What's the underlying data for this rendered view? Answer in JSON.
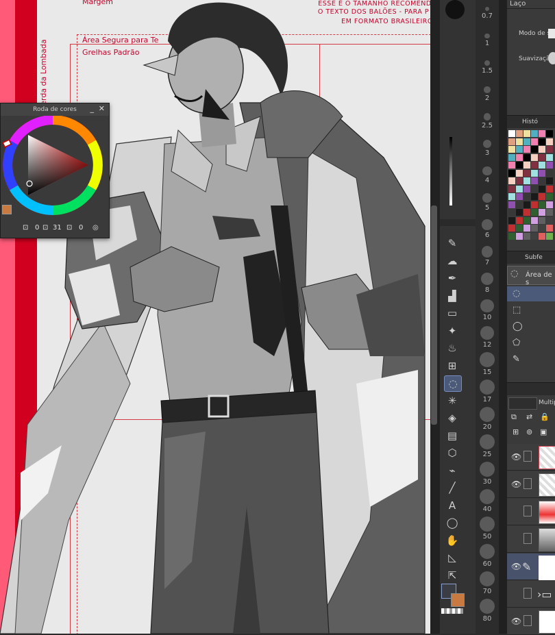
{
  "canvas": {
    "margin_label": "Margem",
    "lombada_label": "Perda da Lombada",
    "safe_area_label": "Área Segura para Te",
    "grid_label": "Grelhas Padrão",
    "note_line1": "ESSE É O TAMANHO RECOMEND",
    "note_line2": "O TEXTO DOS BALÕES - PARA P",
    "note_line3": "EM FORMATO BRASILEIRO"
  },
  "color_wheel": {
    "title": "Roda de cores",
    "minimize": "_",
    "close": "✕",
    "val_h": "0",
    "val_s": "31",
    "val_v": "0",
    "hue_color": "#ff1a1a"
  },
  "ruler": {
    "labels": [
      "0.7",
      "1",
      "1.5",
      "2",
      "2.5",
      "3",
      "4",
      "5",
      "6",
      "7",
      "8",
      "10",
      "12",
      "15",
      "17",
      "20",
      "25",
      "30",
      "40",
      "50",
      "60",
      "70",
      "80"
    ]
  },
  "tools": [
    {
      "icon": "eyedropper-icon",
      "glyph": "✎"
    },
    {
      "icon": "cloud-icon",
      "glyph": "☁"
    },
    {
      "icon": "pen-icon",
      "glyph": "✒"
    },
    {
      "icon": "airbrush-icon",
      "glyph": "▟"
    },
    {
      "icon": "eraser-icon",
      "glyph": "▭"
    },
    {
      "icon": "sparkle-icon",
      "glyph": "✦"
    },
    {
      "icon": "blend-icon",
      "glyph": "♨"
    },
    {
      "icon": "grid-icon",
      "glyph": "⊞"
    },
    {
      "icon": "lasso-icon",
      "glyph": "◌"
    },
    {
      "icon": "magic-wand-icon",
      "glyph": "✳"
    },
    {
      "icon": "fill-icon",
      "glyph": "◈"
    },
    {
      "icon": "gradient-icon",
      "glyph": "▤"
    },
    {
      "icon": "cube-icon",
      "glyph": "⬡"
    },
    {
      "icon": "dropper-icon",
      "glyph": "⌁"
    },
    {
      "icon": "line-icon",
      "glyph": "╱"
    },
    {
      "icon": "text-icon",
      "glyph": "A"
    },
    {
      "icon": "balloon-icon",
      "glyph": "◯"
    },
    {
      "icon": "hand-icon",
      "glyph": "✋"
    },
    {
      "icon": "frame-icon",
      "glyph": "◺"
    },
    {
      "icon": "move-icon",
      "glyph": "⇱"
    }
  ],
  "panels": {
    "tool_name": "Laço",
    "mode_label": "Modo de s",
    "smooth_label": "Suavizaçã",
    "history_label": "Histó",
    "subtool_label": "Subfe",
    "subtool_item": "Área de s",
    "layer_mode": "Multip"
  },
  "colors": {
    "accent": "#4a5a78",
    "main_color": "#3b3d44",
    "sub_color": "#c97a40"
  }
}
